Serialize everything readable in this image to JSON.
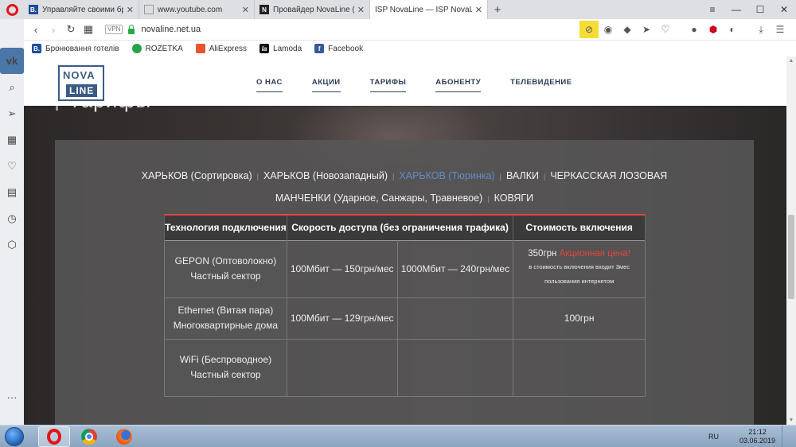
{
  "browser": {
    "tabs": [
      {
        "title": "Управляйте своими брон",
        "favicon": "B.",
        "color": "#1f4d9b"
      },
      {
        "title": "www.youtube.com",
        "favicon": "page-icon",
        "color": "#999999"
      },
      {
        "title": "Провайдер NovaLine (опт",
        "favicon": "N",
        "color": "#222222"
      },
      {
        "title": "ISP NovaLine — ISP NovaL",
        "favicon": "NL",
        "color": "#3a5b85",
        "active": true
      }
    ],
    "url": "novaline.net.ua",
    "vpn_label": "VPN",
    "bookmarks": [
      {
        "label": "Бронювання готелів",
        "icon": "B.",
        "color": "#1f4d9b"
      },
      {
        "label": "ROZETKA",
        "icon": "R",
        "color": "#27a34b"
      },
      {
        "label": "AliExpress",
        "icon": "A",
        "color": "#e8542c"
      },
      {
        "label": "Lamoda",
        "icon": "la",
        "color": "#111111"
      },
      {
        "label": "Facebook",
        "icon": "f",
        "color": "#3b5998"
      }
    ]
  },
  "site": {
    "logo": {
      "top": "NOVA",
      "bottom": "LINE"
    },
    "nav": [
      {
        "label": "О НАС",
        "underlined": true
      },
      {
        "label": "АКЦИИ",
        "underlined": true
      },
      {
        "label": "ТАРИФЫ",
        "underlined": true
      },
      {
        "label": "АБОНЕНТУ",
        "underlined": true
      },
      {
        "label": "ТЕЛЕВИДЕНИЕ",
        "underlined": false
      }
    ],
    "heading": "Тарифы",
    "cities_line1": [
      {
        "label": "ХАРЬКОВ (Сортировка)",
        "active": false
      },
      {
        "label": "ХАРЬКОВ (Новозападный)",
        "active": false
      },
      {
        "label": "ХАРЬКОВ (Тюринка)",
        "active": true
      },
      {
        "label": "ВАЛКИ",
        "active": false
      },
      {
        "label": "ЧЕРКАССКАЯ ЛОЗОВАЯ",
        "active": false
      }
    ],
    "cities_line2": [
      {
        "label": "МАНЧЕНКИ (Ударное, Санжары, Травневое)",
        "active": false
      },
      {
        "label": "КОВЯГИ",
        "active": false
      }
    ],
    "table": {
      "headers": [
        "Технология подключения",
        "Скорость доступа (без ограничения трафика)",
        "Стоимость включения"
      ],
      "rows": [
        {
          "tech": "GEPON (Оптоволокно)",
          "tech_sub": "Частный сектор",
          "speed1": "100Мбит — 150грн/мес",
          "speed2": "1000Мбит — 240грн/мес",
          "price": "350грн",
          "promo": "Акционная цена!",
          "note": "в стоимость включения входит 3мес пользования интернетом"
        },
        {
          "tech": "Ethernet (Витая пара)",
          "tech_sub": "Многоквартирные дома",
          "speed1": "100Мбит — 129грн/мес",
          "speed2": "",
          "price": "100грн"
        },
        {
          "tech": "WiFi (Беспроводное)",
          "tech_sub": "Частный сектор",
          "speed1": "",
          "speed2": "",
          "price": ""
        }
      ]
    }
  },
  "taskbar": {
    "lang": "RU",
    "time": "21:12",
    "date": "03.06.2019"
  },
  "colors": {
    "accent_red": "#e0473f",
    "active_city": "#5c8fc7",
    "brand_blue": "#3a5b85"
  }
}
